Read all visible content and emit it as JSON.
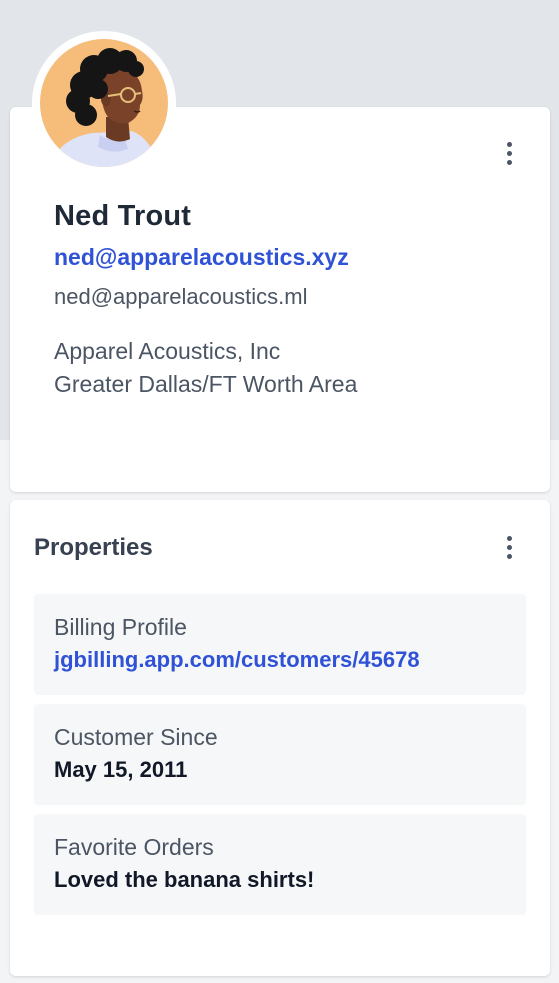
{
  "profile": {
    "name": "Ned Trout",
    "email_primary": "ned@apparelacoustics.xyz",
    "email_secondary": "ned@apparelacoustics.ml",
    "company": "Apparel Acoustics, Inc",
    "location": "Greater Dallas/FT Worth Area",
    "avatar_icon": "person-avatar-illustration",
    "menu_icon": "kebab-menu-icon"
  },
  "properties": {
    "title": "Properties",
    "menu_icon": "kebab-menu-icon",
    "items": [
      {
        "label": "Billing Profile",
        "value": "jgbilling.app.com/customers/45678"
      },
      {
        "label": "Customer Since",
        "value": "May 15, 2011"
      },
      {
        "label": "Favorite Orders",
        "value": "Loved the banana shirts!"
      }
    ]
  },
  "colors": {
    "accent": "#2f52d6",
    "heading": "#1f2937",
    "muted": "#4b5563",
    "avatar_bg": "#f6bc7a",
    "page_band": "#e2e6ea"
  }
}
